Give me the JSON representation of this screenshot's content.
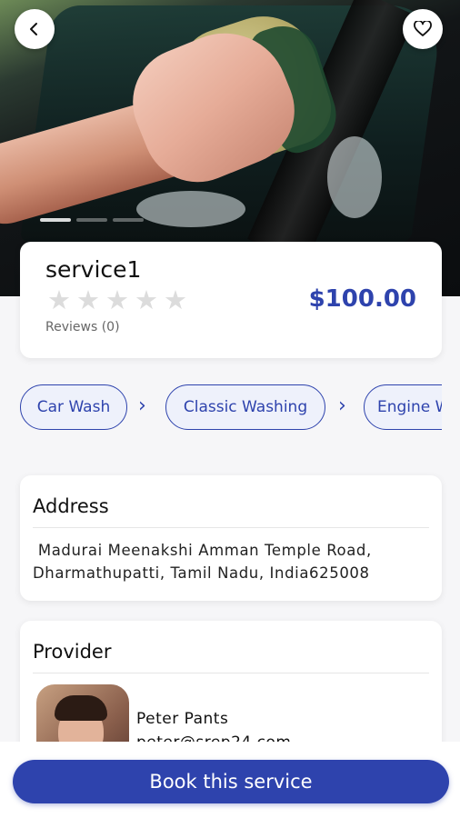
{
  "service": {
    "title": "service1",
    "rating_stars": 0,
    "rating_max": 5,
    "reviews_label": "Reviews (0)",
    "price": "$100.00"
  },
  "breadcrumbs": [
    "Car Wash",
    "Classic Washing",
    "Engine W"
  ],
  "address": {
    "title": "Address",
    "text": " Madurai Meenakshi Amman Temple Road,\nDharmathupatti, Tamil Nadu, India625008"
  },
  "provider": {
    "title": "Provider",
    "name": "Peter Pants",
    "email": "peter@srep24.com"
  },
  "actions": {
    "book_label": "Book this service"
  },
  "icons": {
    "back": "chevron-left-icon",
    "favorite": "heart-icon",
    "star": "star-icon",
    "separator": "chevron-right-icon"
  },
  "colors": {
    "accent": "#2e43ad",
    "star_empty": "#dcdcdc"
  },
  "gallery": {
    "slides": 3,
    "active": 0
  }
}
